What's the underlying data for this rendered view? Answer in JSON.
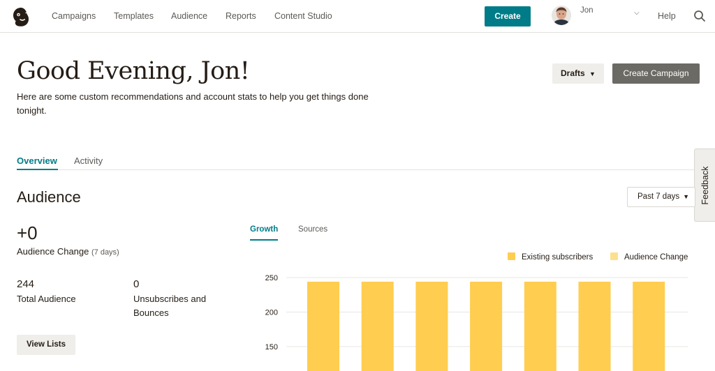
{
  "nav": {
    "logo_icon": "mailchimp-logo-icon",
    "links": [
      "Campaigns",
      "Templates",
      "Audience",
      "Reports",
      "Content Studio"
    ],
    "create_label": "Create",
    "user_name": "Jon",
    "help_label": "Help",
    "search_icon": "search-icon"
  },
  "hero": {
    "greeting": "Good Evening, Jon!",
    "subtitle": "Here are some custom recommendations and account stats to help you get things done tonight.",
    "drafts_label": "Drafts",
    "create_campaign_label": "Create Campaign"
  },
  "tabs": {
    "overview": "Overview",
    "activity": "Activity"
  },
  "feedback_label": "Feedback",
  "audience": {
    "title": "Audience",
    "range": "Past 7 days",
    "change_value": "+0",
    "change_label": "Audience Change",
    "change_period": "(7 days)",
    "total_value": "244",
    "total_label": "Total Audience",
    "unsub_value": "0",
    "unsub_label_1": "Unsubscribes and",
    "unsub_label_2": "Bounces",
    "view_lists_label": "View Lists",
    "chart_tabs": {
      "growth": "Growth",
      "sources": "Sources"
    }
  },
  "colors": {
    "accent": "#007c89",
    "existing": "#ffcd4f",
    "change": "#fde08e"
  },
  "chart_data": {
    "type": "bar",
    "stacked": true,
    "grid": true,
    "legend_position": "top-right",
    "y_ticks": [
      250,
      200,
      150
    ],
    "series": [
      {
        "name": "Existing subscribers",
        "values": [
          244,
          244,
          244,
          244,
          244,
          244,
          244
        ]
      },
      {
        "name": "Audience Change",
        "values": [
          0,
          0,
          0,
          0,
          0,
          0,
          0
        ]
      }
    ]
  }
}
